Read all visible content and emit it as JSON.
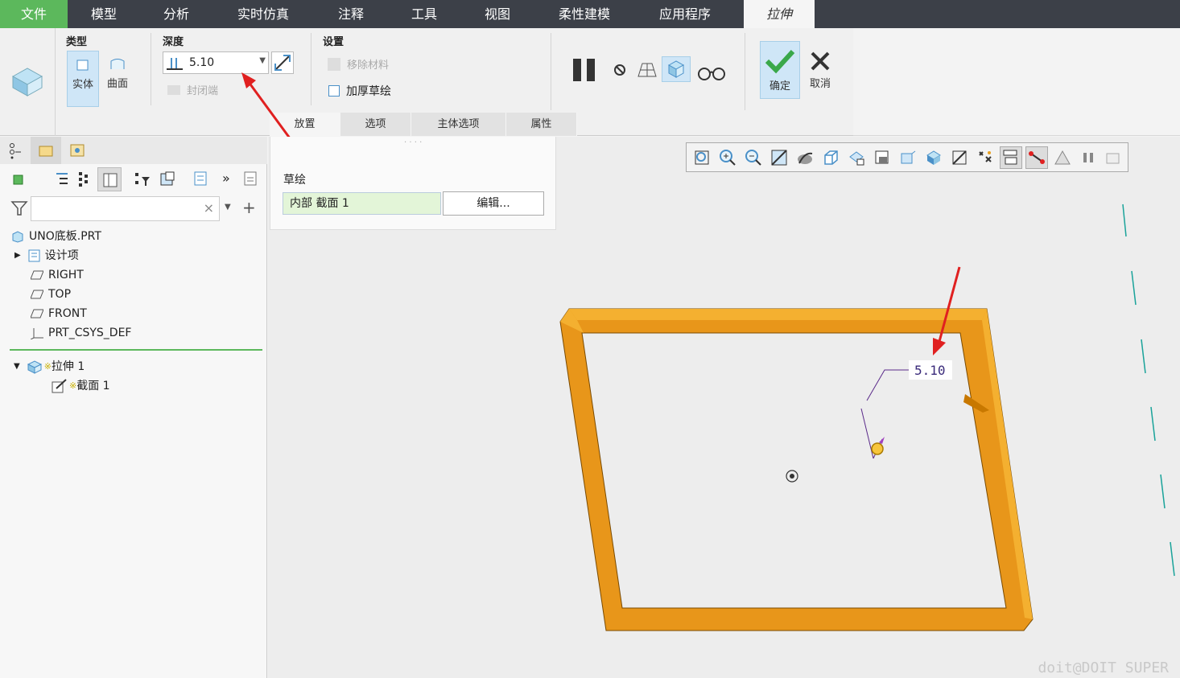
{
  "menu": [
    "文件",
    "模型",
    "分析",
    "实时仿真",
    "注释",
    "工具",
    "视图",
    "柔性建模",
    "应用程序",
    "拉伸"
  ],
  "ribbon": {
    "type_label": "类型",
    "solid_label": "实体",
    "surface_label": "曲面",
    "depth_label": "深度",
    "depth_value": "5.10",
    "cap_ends_label": "封闭端",
    "settings_label": "设置",
    "remove_material_label": "移除材料",
    "thicken_label": "加厚草绘",
    "ok_label": "确定",
    "cancel_label": "取消"
  },
  "tabs": [
    "放置",
    "选项",
    "主体选项",
    "属性"
  ],
  "placement_panel": {
    "sketch_label": "草绘",
    "sketch_value": "内部 截面 1",
    "edit_button": "编辑..."
  },
  "tree": {
    "search_placeholder": "",
    "items": [
      "UNO底板.PRT",
      "设计项",
      "RIGHT",
      "TOP",
      "FRONT",
      "PRT_CSYS_DEF"
    ],
    "feature": "拉伸 1",
    "feature_child": "截面 1",
    "new_marker": "※"
  },
  "canvas": {
    "dim_value": "5.10",
    "model_color": "#f0a020"
  },
  "watermark": "doit@DOIT SUPER"
}
